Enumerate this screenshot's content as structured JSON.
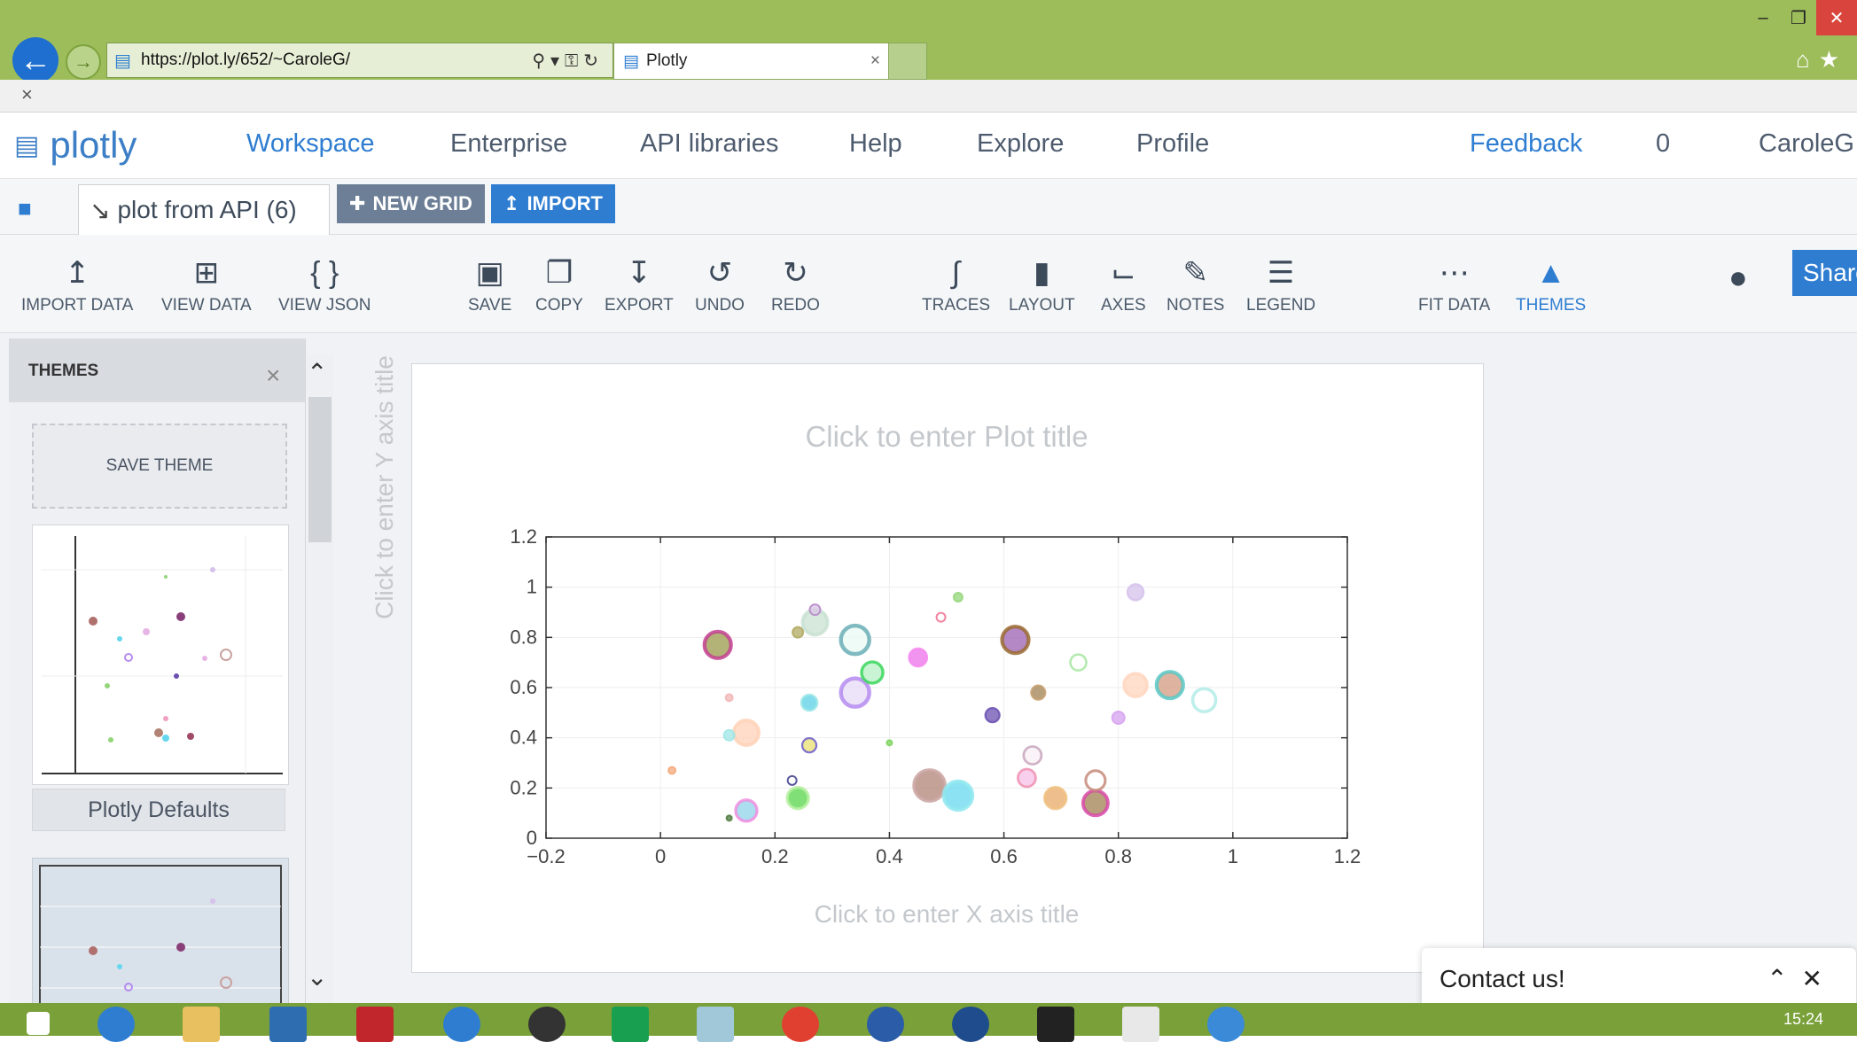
{
  "browser": {
    "url": "https://plot.ly/652/~CaroleG/",
    "tab_title": "Plotly",
    "tab_close": "×",
    "tab_icon": "chart-bars-icon",
    "window_controls": [
      "–",
      "❐",
      "✕"
    ],
    "close_bar_label": "×"
  },
  "nav": {
    "logo_text": "plotly",
    "items": [
      "Workspace",
      "Enterprise",
      "API libraries",
      "Help",
      "Explore",
      "Profile"
    ],
    "feedback": "Feedback",
    "notifications": "0",
    "user": "CaroleG"
  },
  "tabs": {
    "file_tab": "plot from API (6)",
    "new_grid": "NEW GRID",
    "import": "IMPORT"
  },
  "toolbar": {
    "import_data": "IMPORT DATA",
    "view_data": "VIEW DATA",
    "view_json": "VIEW JSON",
    "save": "SAVE",
    "copy": "COPY",
    "export": "EXPORT",
    "undo": "UNDO",
    "redo": "REDO",
    "traces": "TRACES",
    "layout": "LAYOUT",
    "axes": "AXES",
    "notes": "NOTES",
    "legend": "LEGEND",
    "fit_data": "FIT DATA",
    "themes": "THEMES",
    "share": "Share",
    "accent_color": "#2e7dd1"
  },
  "themes_panel": {
    "title": "THEMES",
    "close": "×",
    "save_theme": "SAVE THEME",
    "theme1_label": "Plotly Defaults"
  },
  "plot": {
    "title_placeholder": "Click to enter Plot title",
    "x_title_placeholder": "Click to enter X axis title",
    "y_title_placeholder": "Click to enter Y axis title"
  },
  "chart_data": {
    "type": "scatter",
    "title": "",
    "xlabel": "",
    "ylabel": "",
    "xlim": [
      -0.2,
      1.2
    ],
    "ylim": [
      0,
      1.2
    ],
    "xticks": [
      "−0.2",
      "0",
      "0.2",
      "0.4",
      "0.6",
      "0.8",
      "1",
      "1.2"
    ],
    "yticks": [
      "0",
      "0.2",
      "0.4",
      "0.6",
      "0.8",
      "1",
      "1.2"
    ],
    "grid": true,
    "points": [
      {
        "x": 0.1,
        "y": 0.77,
        "s": 15,
        "c": "#c2408f",
        "f": "#9a9a4a"
      },
      {
        "x": 0.15,
        "y": 0.42,
        "s": 14,
        "c": "#ffd2b8",
        "f": "#ffd2b8"
      },
      {
        "x": 0.15,
        "y": 0.11,
        "s": 12,
        "c": "#ee8ee0",
        "f": "#8fd3e8"
      },
      {
        "x": 0.24,
        "y": 0.16,
        "s": 12,
        "c": "#b6f0a0",
        "f": "#55d64a"
      },
      {
        "x": 0.27,
        "y": 0.86,
        "s": 14,
        "c": "#c9e2d2",
        "f": "#c9e2d2"
      },
      {
        "x": 0.26,
        "y": 0.37,
        "s": 8,
        "c": "#6a5acd",
        "f": "#e8e070"
      },
      {
        "x": 0.26,
        "y": 0.54,
        "s": 9,
        "c": "#9fe6e6",
        "f": "#5ad0e6"
      },
      {
        "x": 0.34,
        "y": 0.79,
        "s": 16,
        "c": "#6aaeb6",
        "f": "#eafaf3"
      },
      {
        "x": 0.34,
        "y": 0.58,
        "s": 16,
        "c": "#b58cf0",
        "f": "#e7dbf7"
      },
      {
        "x": 0.37,
        "y": 0.66,
        "s": 12,
        "c": "#3ad65a",
        "f": "#b7f0c6"
      },
      {
        "x": 0.45,
        "y": 0.72,
        "s": 10,
        "c": "#f48af0",
        "f": "#ec70ea"
      },
      {
        "x": 0.47,
        "y": 0.21,
        "s": 17,
        "c": "#c9a3a0",
        "f": "#b08374"
      },
      {
        "x": 0.52,
        "y": 0.17,
        "s": 16,
        "c": "#8fe8f0",
        "f": "#66d7ee"
      },
      {
        "x": 0.52,
        "y": 0.96,
        "s": 5,
        "c": "#93d67a",
        "f": "#93d67a"
      },
      {
        "x": 0.49,
        "y": 0.88,
        "s": 5,
        "c": "#f07090",
        "f": "#fff"
      },
      {
        "x": 0.58,
        "y": 0.49,
        "s": 8,
        "c": "#6a50b0",
        "f": "#6a50b0"
      },
      {
        "x": 0.62,
        "y": 0.79,
        "s": 15,
        "c": "#9a6a30",
        "f": "#9b60b0"
      },
      {
        "x": 0.65,
        "y": 0.33,
        "s": 10,
        "c": "#c8a7bd",
        "f": "#f8f0f6"
      },
      {
        "x": 0.64,
        "y": 0.24,
        "s": 10,
        "c": "#f090b0",
        "f": "#f6c0e8"
      },
      {
        "x": 0.66,
        "y": 0.58,
        "s": 8,
        "c": "#c8a070",
        "f": "#a08050"
      },
      {
        "x": 0.69,
        "y": 0.16,
        "s": 12,
        "c": "#f0c080",
        "f": "#e8aa66"
      },
      {
        "x": 0.73,
        "y": 0.7,
        "s": 9,
        "c": "#a6e6a0",
        "f": "#ffffff"
      },
      {
        "x": 0.76,
        "y": 0.14,
        "s": 14,
        "c": "#d84aa8",
        "f": "#a08050"
      },
      {
        "x": 0.76,
        "y": 0.23,
        "s": 11,
        "c": "#c58a7a",
        "f": "#ffffff"
      },
      {
        "x": 0.8,
        "y": 0.48,
        "s": 7,
        "c": "#d6a0f0",
        "f": "#d6a0f0"
      },
      {
        "x": 0.83,
        "y": 0.98,
        "s": 9,
        "c": "#d6c2ec",
        "f": "#d6c2ec"
      },
      {
        "x": 0.83,
        "y": 0.61,
        "s": 13,
        "c": "#ffd6bf",
        "f": "#ffd6bf"
      },
      {
        "x": 0.89,
        "y": 0.61,
        "s": 15,
        "c": "#59c8c4",
        "f": "#d39a80"
      },
      {
        "x": 0.95,
        "y": 0.55,
        "s": 13,
        "c": "#b4ece8",
        "f": "#ffffff"
      },
      {
        "x": 0.02,
        "y": 0.27,
        "s": 4,
        "c": "#f3a87a",
        "f": "#f3a87a"
      },
      {
        "x": 0.12,
        "y": 0.56,
        "s": 4,
        "c": "#f2b5b5",
        "f": "#f2b5b5"
      },
      {
        "x": 0.24,
        "y": 0.82,
        "s": 6,
        "c": "#b0a860",
        "f": "#b0a860"
      },
      {
        "x": 0.27,
        "y": 0.91,
        "s": 6,
        "c": "#b585c6",
        "f": "#d9c4e5"
      },
      {
        "x": 0.4,
        "y": 0.38,
        "s": 3,
        "c": "#7ad45a",
        "f": "#7ad45a"
      },
      {
        "x": 0.23,
        "y": 0.23,
        "s": 5,
        "c": "#3b3b8c",
        "f": "#ffffff"
      },
      {
        "x": 0.12,
        "y": 0.08,
        "s": 3,
        "c": "#4c7a3c",
        "f": "#4c7a3c"
      },
      {
        "x": 0.12,
        "y": 0.41,
        "s": 6,
        "c": "#9fe6e6",
        "f": "#9fe6e6"
      }
    ]
  }
}
